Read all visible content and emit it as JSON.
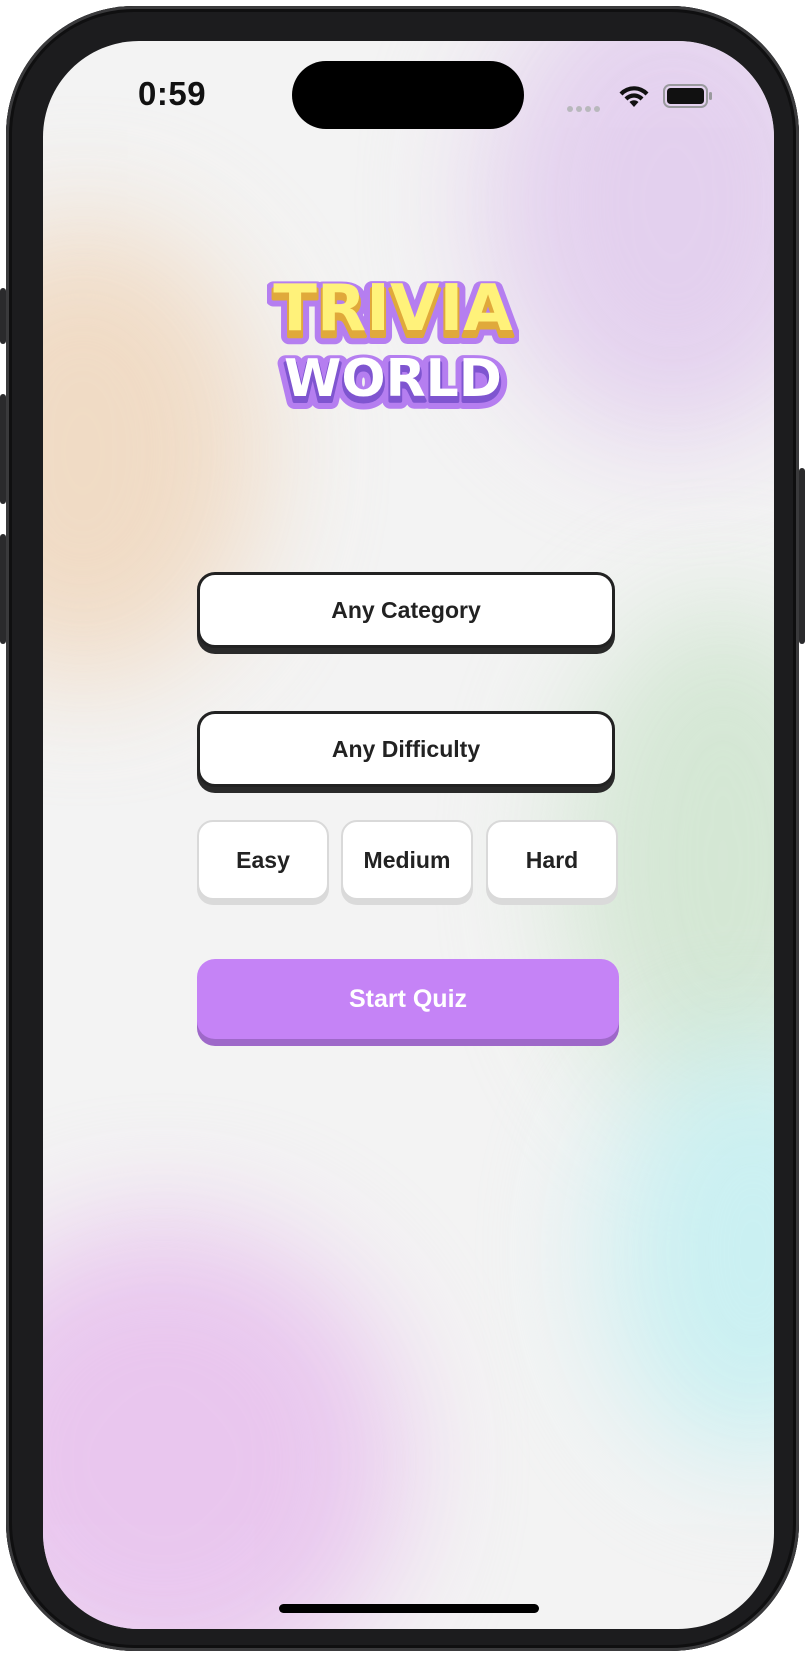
{
  "status_bar": {
    "time": "0:59",
    "icons": [
      "signal-icon",
      "wifi-icon",
      "battery-icon"
    ]
  },
  "logo": {
    "line1": "TRIVIA",
    "line2": "WORLD",
    "colors": {
      "line1_fill": "#fff27a",
      "line1_shadow": "#e0a93b",
      "line2_fill": "#ffffff",
      "outline": "#b57ef0"
    }
  },
  "quiz_setup": {
    "category_label": "Any Category",
    "difficulty_label": "Any Difficulty",
    "difficulty_options": [
      "Easy",
      "Medium",
      "Hard"
    ],
    "start_label": "Start Quiz"
  },
  "colors": {
    "accent": "#c583f6",
    "accent_shadow": "#9e68c9",
    "background": "#f3f3f3"
  }
}
